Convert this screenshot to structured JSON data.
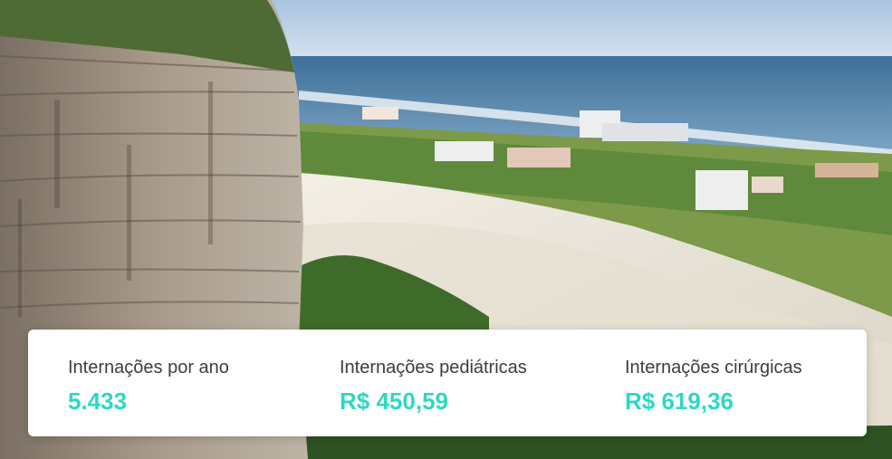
{
  "background": {
    "image_description_icon": "landscape-photo-icon"
  },
  "colors": {
    "value_accent": "#2ed8c3",
    "label_text": "#3d3d3d",
    "card_background": "#ffffff"
  },
  "stats": [
    {
      "label": "Internações por ano",
      "value": "5.433"
    },
    {
      "label": "Internações pediátricas",
      "value": "R$ 450,59"
    },
    {
      "label": "Internações cirúrgicas",
      "value": "R$ 619,36"
    }
  ]
}
